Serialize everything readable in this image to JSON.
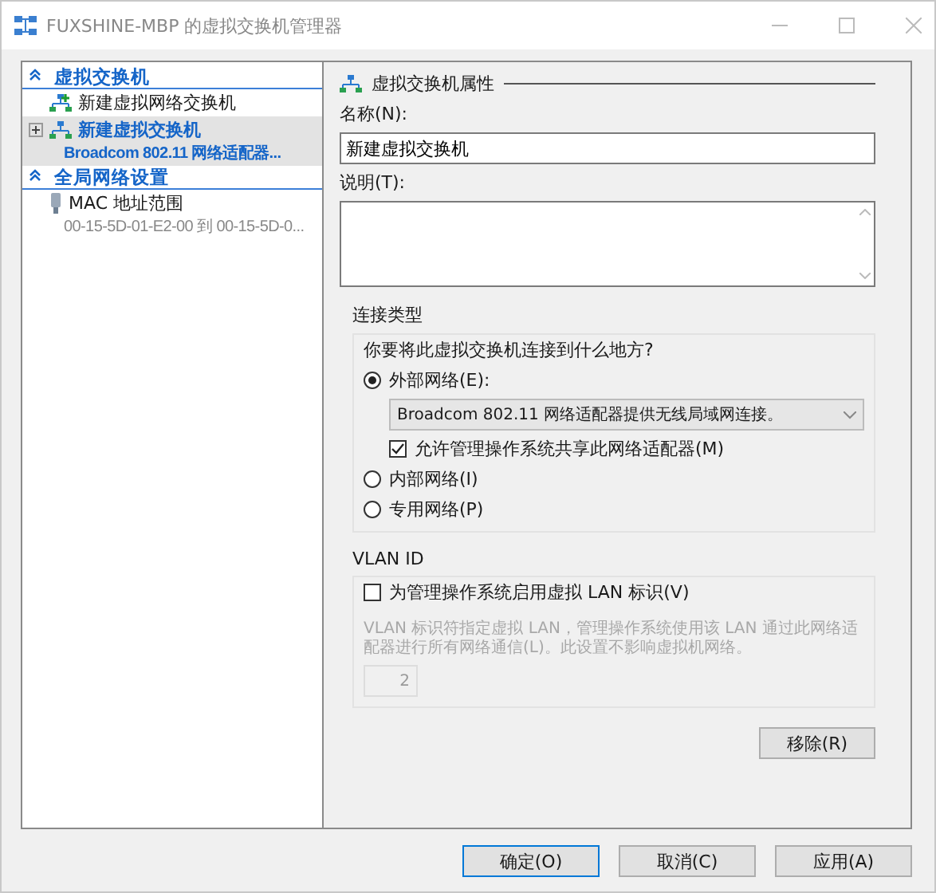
{
  "window": {
    "title": "FUXSHINE-MBP 的虚拟交换机管理器"
  },
  "tree": [
    {
      "label": "虚拟交换机",
      "expanded": true,
      "children": [
        {
          "kind": "add",
          "label": "新建虚拟网络交换机",
          "selected": false
        },
        {
          "kind": "switch",
          "label": "新建虚拟交换机",
          "detail": "Broadcom 802.11 网络适配器...",
          "selected": true,
          "expanded": false
        }
      ]
    },
    {
      "label": "全局网络设置",
      "expanded": true,
      "children": [
        {
          "kind": "mac",
          "label": "MAC 地址范围",
          "detail": "00-15-5D-01-E2-00 到 00-15-5D-0...",
          "selected": false
        }
      ]
    }
  ],
  "properties": {
    "title": "虚拟交换机属性",
    "name_label": "名称(N):",
    "name_value": "新建虚拟交换机",
    "description_label": "说明(T):",
    "connection": {
      "title": "连接类型",
      "question": "你要将此虚拟交换机连接到什么地方?",
      "options": [
        {
          "label": "外部网络(E):",
          "selected": true
        },
        {
          "label": "内部网络(I)",
          "selected": false
        },
        {
          "label": "专用网络(P)",
          "selected": false
        }
      ],
      "adapter": "Broadcom 802.11 网络适配器提供无线局域网连接。",
      "share": {
        "label": "允许管理操作系统共享此网络适配器(M)",
        "checked": true
      }
    },
    "vlan": {
      "title": "VLAN ID",
      "enable": {
        "label": "为管理操作系统启用虚拟 LAN 标识(V)",
        "checked": false
      },
      "note": "VLAN 标识符指定虚拟 LAN，管理操作系统使用该 LAN 通过此网络适配器进行所有网络通信(L)。此设置不影响虚拟机网络。",
      "value": "2"
    },
    "remove_button": "移除(R)"
  },
  "buttons": [
    "确定(O)",
    "取消(C)",
    "应用(A)"
  ]
}
